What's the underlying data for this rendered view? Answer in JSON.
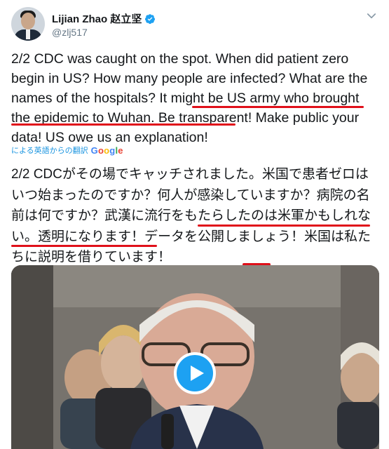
{
  "header": {
    "name": "Lijian Zhao 赵立坚",
    "handle": "@zlj517"
  },
  "tweet": {
    "text": "2/2 CDC was caught on the spot. When did patient zero begin in US? How many people are infected? What are the names of the hospitals? It might be US army who brought the epidemic to Wuhan. Be transparent! Make public your data! US owe us an explanation!"
  },
  "translation": {
    "attribution": "による英語からの翻訳",
    "provider": "Google",
    "text": "2/2 CDCがその場でキャッチされました。米国で患者ゼロはいつ始まったのですか？何人が感染していますか？病院の名前は何ですか？武漢に流行をもたらしたのは米軍かもしれない。透明になります！データを公開しましょう！米国は私たちに説明を借りています！"
  },
  "media": {
    "type": "video",
    "play_icon": "play-icon"
  },
  "colors": {
    "accent": "#1da1f2",
    "annotation": "#e0101a",
    "link": "#1b95e0"
  }
}
